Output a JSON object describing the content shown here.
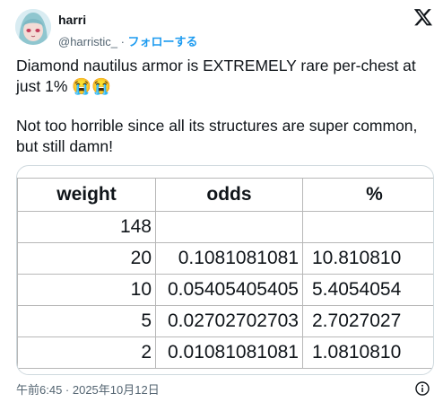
{
  "author": {
    "name": "harri",
    "handle": "@harristic_",
    "separator": "·",
    "follow_label": "フォローする"
  },
  "tweet": {
    "line1": "Diamond nautilus armor is EXTREMELY rare per-chest at just 1% 😭😭",
    "line2": "Not too horrible since all its structures are super common, but still damn!"
  },
  "sheet": {
    "headers": [
      "weight",
      "odds",
      "%"
    ],
    "rows": [
      {
        "weight": "148",
        "odds": "",
        "percent": ""
      },
      {
        "weight": "20",
        "odds": "0.1081081081",
        "percent": "10.810810"
      },
      {
        "weight": "10",
        "odds": "0.05405405405",
        "percent": "5.4054054"
      },
      {
        "weight": "5",
        "odds": "0.02702702703",
        "percent": "2.7027027"
      },
      {
        "weight": "2",
        "odds": "0.01081081081",
        "percent": "1.0810810"
      }
    ]
  },
  "footer": {
    "timestamp": "午前6:45 · 2025年10月12日"
  },
  "icons": {
    "logo": "x-logo-icon",
    "info": "info-icon"
  },
  "colors": {
    "link": "#1d9bf0",
    "text": "#0f1419",
    "secondary": "#536471"
  }
}
